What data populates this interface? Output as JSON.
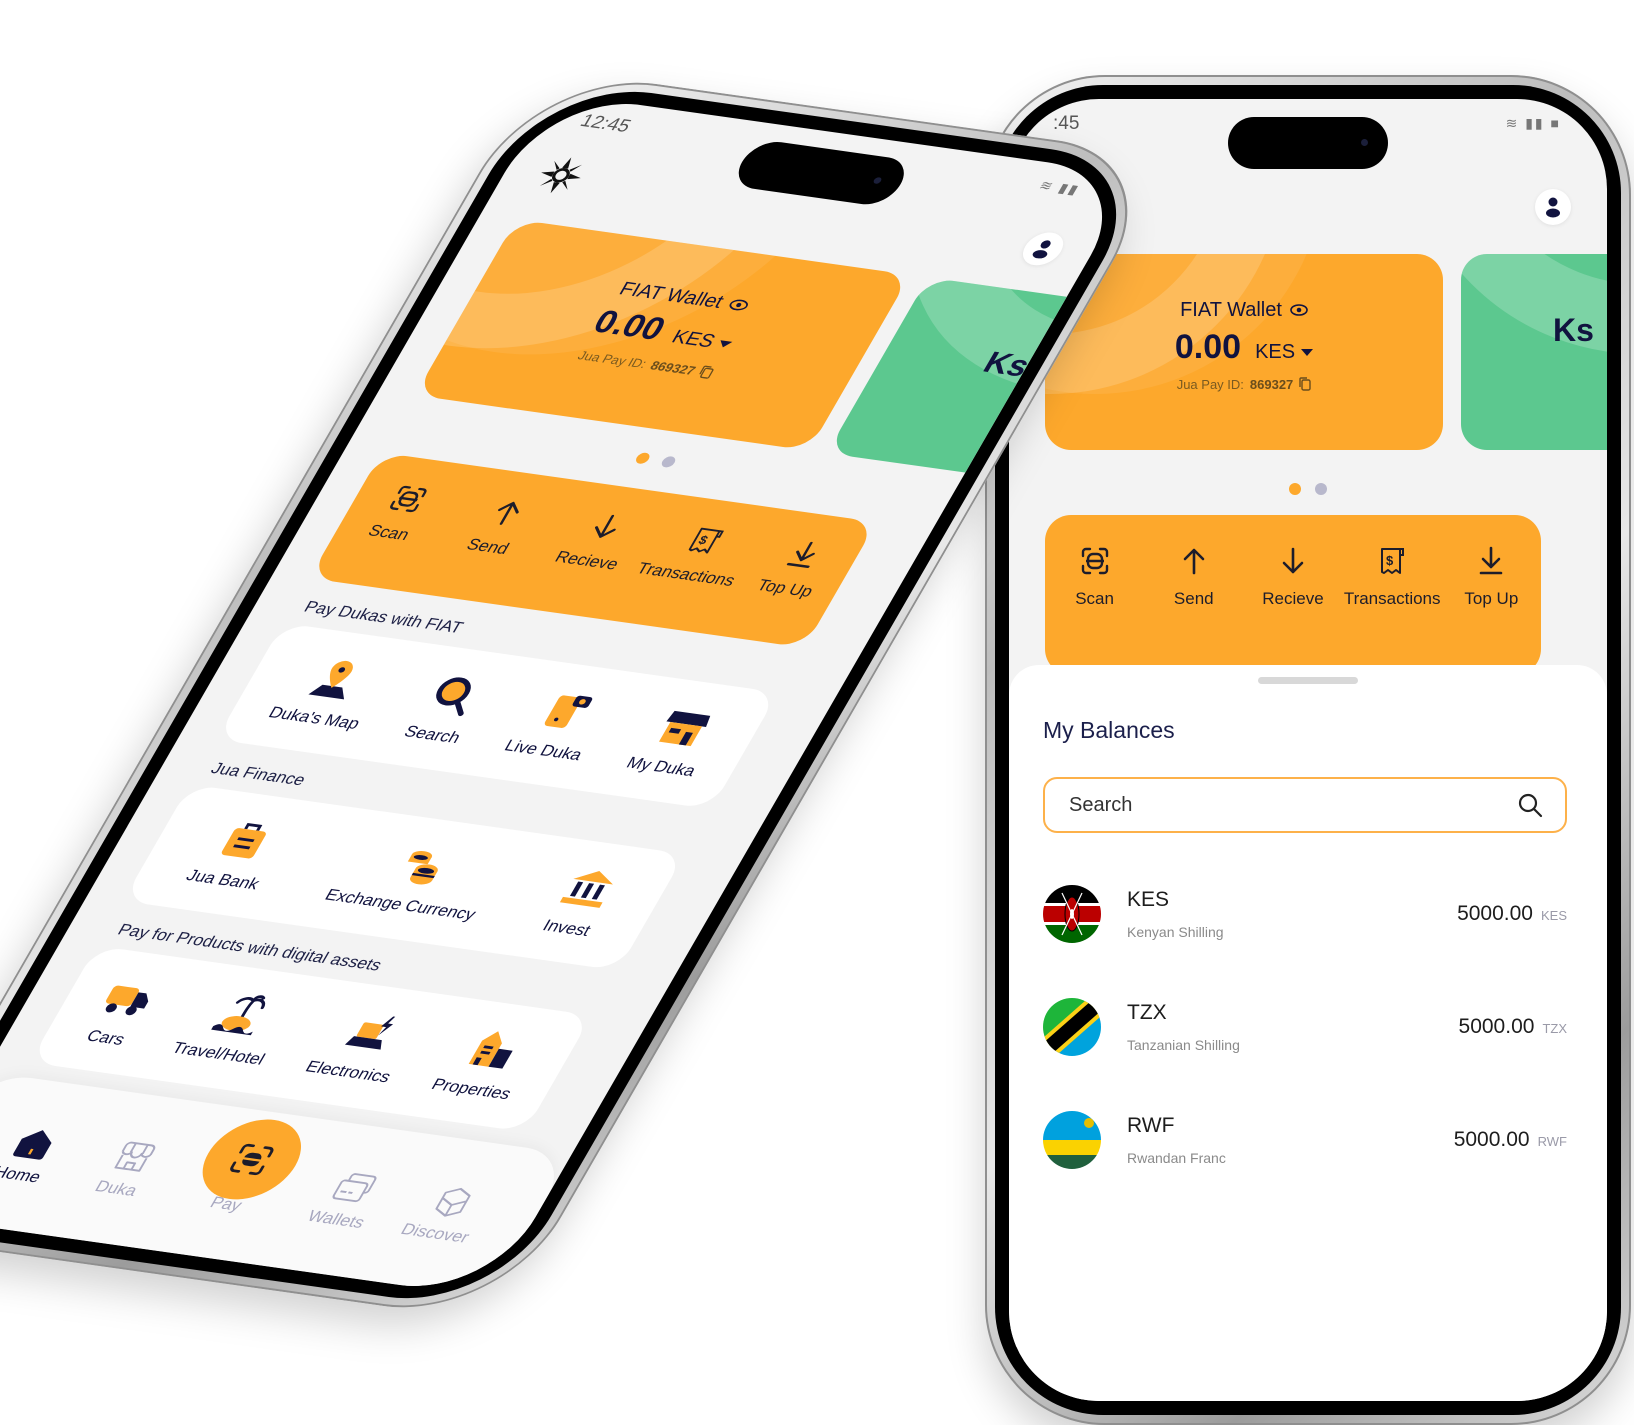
{
  "status_bar": {
    "time": "12:45",
    "time_right_phone": ":45"
  },
  "wallet_card": {
    "title": "FIAT Wallet",
    "amount": "0.00",
    "currency": "KES",
    "id_label": "Jua Pay ID:",
    "id_value": "869327",
    "next_card_partial_text": "Ks",
    "colors": {
      "primary": "#fda82c",
      "secondary_card": "#5cc88f",
      "text": "#11133f"
    }
  },
  "carousel": {
    "pages": 2,
    "active_index": 0
  },
  "quick_actions": [
    {
      "label": "Scan",
      "icon": "scan-icon"
    },
    {
      "label": "Send",
      "icon": "arrow-up-icon"
    },
    {
      "label": "Recieve",
      "icon": "arrow-down-icon"
    },
    {
      "label": "Transactions",
      "icon": "receipt-dollar-icon"
    },
    {
      "label": "Top Up",
      "icon": "download-icon"
    }
  ],
  "sections": [
    {
      "title": "Pay Dukas with FIAT",
      "items": [
        {
          "label": "Duka's Map",
          "icon": "map-pin-icon"
        },
        {
          "label": "Search",
          "icon": "search-icon"
        },
        {
          "label": "Live Duka",
          "icon": "phone-camera-icon"
        },
        {
          "label": "My Duka",
          "icon": "store-icon"
        }
      ]
    },
    {
      "title": "Jua Finance",
      "items": [
        {
          "label": "Jua Bank",
          "icon": "bank-bag-icon"
        },
        {
          "label": "Exchange Currency",
          "icon": "coins-icon"
        },
        {
          "label": "Invest",
          "icon": "institution-icon"
        }
      ]
    },
    {
      "title": "Pay for Products with digital assets",
      "items": [
        {
          "label": "Cars",
          "icon": "truck-icon"
        },
        {
          "label": "Travel/Hotel",
          "icon": "island-icon"
        },
        {
          "label": "Electronics",
          "icon": "electronics-icon"
        },
        {
          "label": "Properties",
          "icon": "building-icon"
        }
      ]
    }
  ],
  "bottom_nav": [
    {
      "label": "Home",
      "icon": "home-icon",
      "active": true
    },
    {
      "label": "Duka",
      "icon": "store-outline-icon",
      "active": false
    },
    {
      "label": "Pay",
      "icon": "scan-icon",
      "active": false
    },
    {
      "label": "Wallets",
      "icon": "wallet-cards-icon",
      "active": false
    },
    {
      "label": "Discover",
      "icon": "cube-icon",
      "active": false
    }
  ],
  "balances_sheet": {
    "title": "My Balances",
    "search_placeholder": "Search",
    "items": [
      {
        "code": "KES",
        "name": "Kenyan Shilling",
        "amount": "5000.00",
        "unit": "KES",
        "flag": "kenya-flag-icon"
      },
      {
        "code": "TZX",
        "name": "Tanzanian Shilling",
        "amount": "5000.00",
        "unit": "TZX",
        "flag": "tanzania-flag-icon"
      },
      {
        "code": "RWF",
        "name": "Rwandan Franc",
        "amount": "5000.00",
        "unit": "RWF",
        "flag": "rwanda-flag-icon"
      }
    ]
  }
}
